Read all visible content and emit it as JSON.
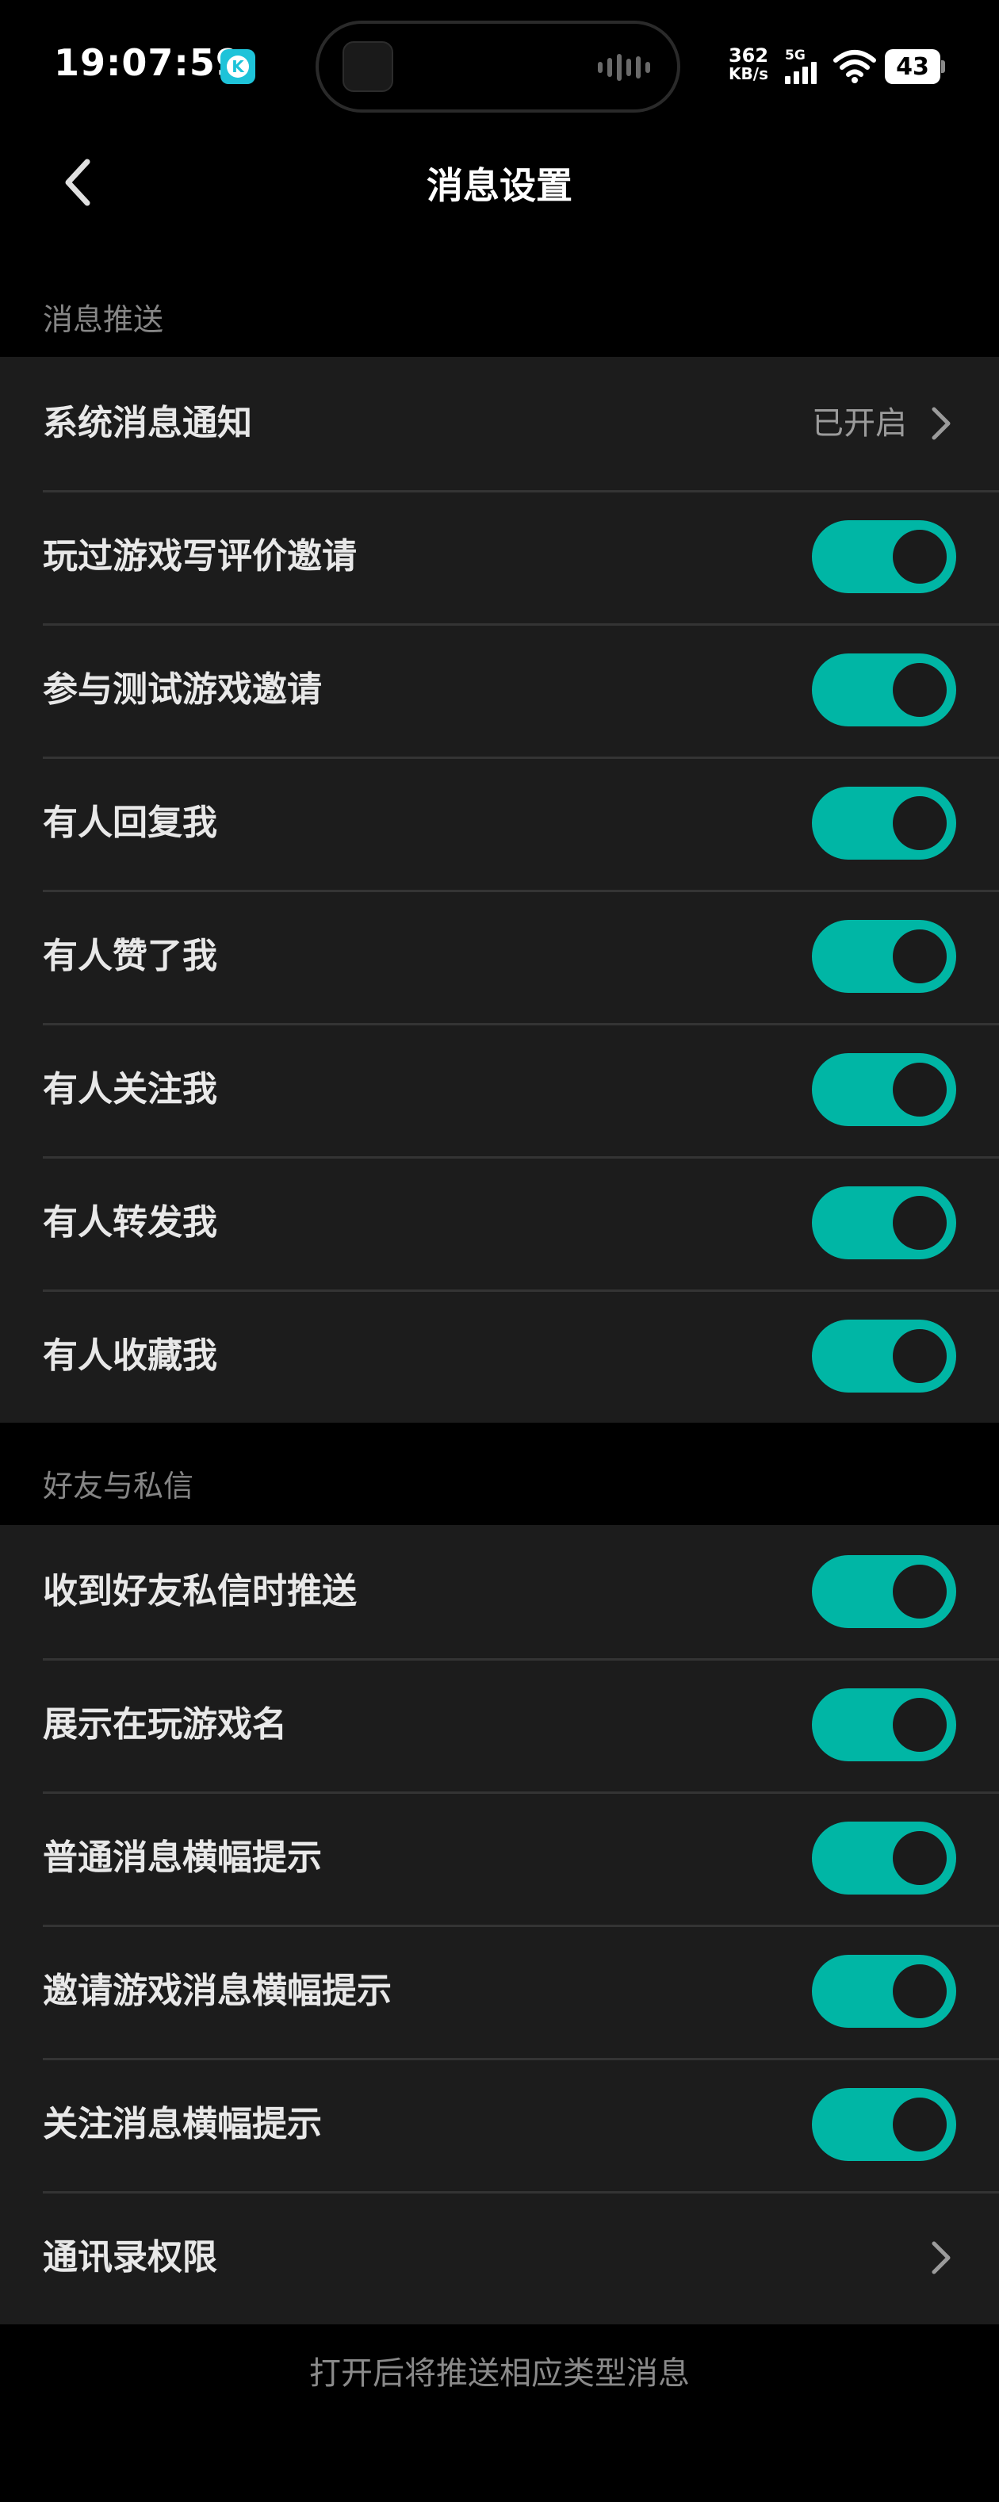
{
  "status_bar": {
    "time": "19:07:59",
    "app_badge_letter": "K",
    "network_speed_value": "362",
    "network_speed_unit": "KB/s",
    "network_type": "5G",
    "battery_level": "43",
    "icons": [
      "app-notification-icon",
      "audio-wave-icon",
      "cellular-signal-icon",
      "wifi-icon",
      "battery-icon"
    ]
  },
  "nav": {
    "back_icon": "chevron-left-icon",
    "title": "消息设置"
  },
  "push_section": {
    "header": "消息推送",
    "system_notification": {
      "label": "系统消息通知",
      "value": "已开启",
      "icon": "chevron-right-icon"
    },
    "toggles": [
      {
        "label": "玩过游戏写评价邀请",
        "on": true
      },
      {
        "label": "参与测试游戏邀请",
        "on": true
      },
      {
        "label": "有人回复我",
        "on": true
      },
      {
        "label": "有人赞了我",
        "on": true
      },
      {
        "label": "有人关注我",
        "on": true
      },
      {
        "label": "有人转发我",
        "on": true
      },
      {
        "label": "有人收藏我",
        "on": true
      }
    ]
  },
  "friends_section": {
    "header": "好友与私信",
    "toggles": [
      {
        "label": "收到好友私信时推送",
        "on": true
      },
      {
        "label": "展示在玩游戏名",
        "on": true
      },
      {
        "label": "普通消息横幅提示",
        "on": true
      },
      {
        "label": "邀请游戏消息横幅提示",
        "on": true
      },
      {
        "label": "关注消息横幅提示",
        "on": true
      }
    ],
    "contacts_permission": {
      "label": "通讯录权限",
      "icon": "chevron-right-icon"
    }
  },
  "footer": {
    "note": "打开后将推送相应类型消息"
  },
  "colors": {
    "background": "#000000",
    "group_background": "#1c1c1c",
    "toggle_on": "#00b6a5",
    "toggle_knob": "#1b1b1b",
    "divider": "#343434",
    "secondary_text": "#858585"
  }
}
